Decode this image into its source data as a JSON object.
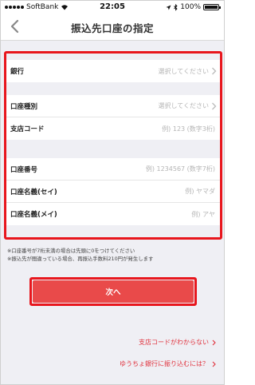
{
  "status_bar": {
    "carrier": "SoftBank",
    "time": "22:05",
    "battery": "100%"
  },
  "nav": {
    "title": "振込先口座の指定"
  },
  "form": {
    "bank": {
      "label": "銀行",
      "value": "選択してください"
    },
    "account_type": {
      "label": "口座種別",
      "value": "選択してください"
    },
    "branch_code": {
      "label": "支店コード",
      "placeholder": "例) 123 (数字3桁)"
    },
    "account_number": {
      "label": "口座番号",
      "placeholder": "例) 1234567 (数字7桁)"
    },
    "name_sei": {
      "label": "口座名義(セイ)",
      "placeholder": "例) ヤマダ"
    },
    "name_mei": {
      "label": "口座名義(メイ)",
      "placeholder": "例) アヤ"
    }
  },
  "notes": {
    "line1": "※口座番号が7桁未満の場合は先頭に0をつけてください",
    "line2": "※振込先が間違っている場合、再振込手数料210円が発生します"
  },
  "next_button": {
    "label": "次へ"
  },
  "links": {
    "branch_unknown": "支店コードがわからない",
    "yucho": "ゆうちょ銀行に振り込むには？"
  },
  "colors": {
    "accent_red": "#e8161d",
    "button_red": "#e94a4a",
    "link_red": "#e0303b"
  }
}
